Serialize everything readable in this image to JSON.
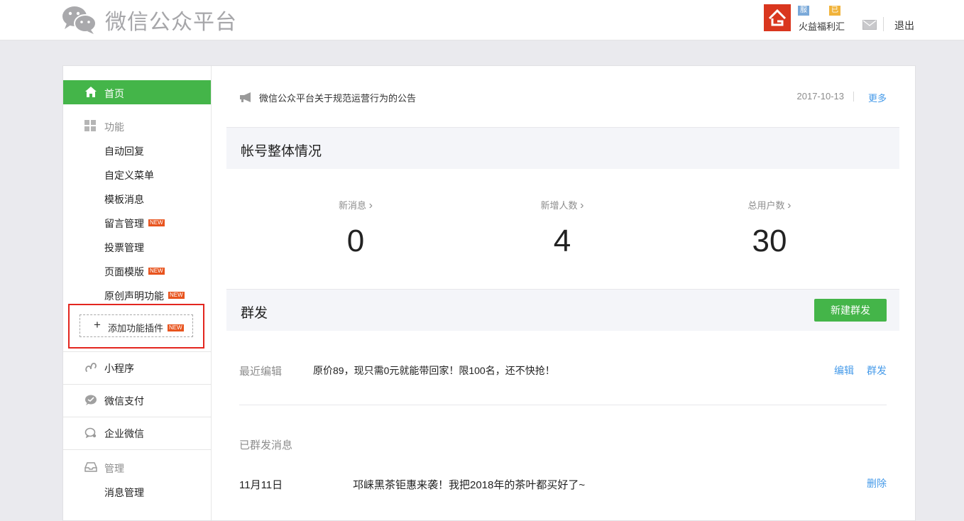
{
  "header": {
    "logo_title": "微信公众平台",
    "account": {
      "badge_service": "服务号",
      "badge_verified": "已认证",
      "name": "火益福利汇"
    },
    "logout_label": "退出"
  },
  "sidebar": {
    "home_label": "首页",
    "function_section": {
      "label": "功能",
      "items": [
        {
          "label": "自动回复",
          "is_new": false
        },
        {
          "label": "自定义菜单",
          "is_new": false
        },
        {
          "label": "模板消息",
          "is_new": false
        },
        {
          "label": "留言管理",
          "is_new": true
        },
        {
          "label": "投票管理",
          "is_new": false
        },
        {
          "label": "页面模版",
          "is_new": true
        },
        {
          "label": "原创声明功能",
          "is_new": true
        }
      ],
      "add_plugin_label": "添加功能插件"
    },
    "new_tag": "NEW",
    "mini_program_label": "小程序",
    "wechat_pay_label": "微信支付",
    "enterprise_wechat_label": "企业微信",
    "manage_section": {
      "label": "管理",
      "items": [
        {
          "label": "消息管理"
        }
      ]
    }
  },
  "notice": {
    "text": "微信公众平台关于规范运营行为的公告",
    "date": "2017-10-13",
    "more_label": "更多"
  },
  "overview": {
    "title": "帐号整体情况",
    "stats": [
      {
        "label": "新消息",
        "value": "0"
      },
      {
        "label": "新增人数",
        "value": "4"
      },
      {
        "label": "总用户数",
        "value": "30"
      }
    ],
    "chevron": "›"
  },
  "broadcast": {
    "title": "群发",
    "new_button_label": "新建群发",
    "recent_label": "最近编辑",
    "recent_text": "原价89，现只需0元就能带回家！限100名，还不快抢！",
    "edit_label": "编辑",
    "send_label": "群发",
    "sent_header": "已群发消息",
    "sent_items": [
      {
        "date": "11月11日",
        "title": "邛崃黑茶钜惠来袭！我把2018年的茶叶都买好了~",
        "delete_label": "删除"
      }
    ]
  },
  "colors": {
    "accent_green": "#44b549",
    "link_blue": "#459ae9",
    "highlight_red": "#e3261f"
  }
}
